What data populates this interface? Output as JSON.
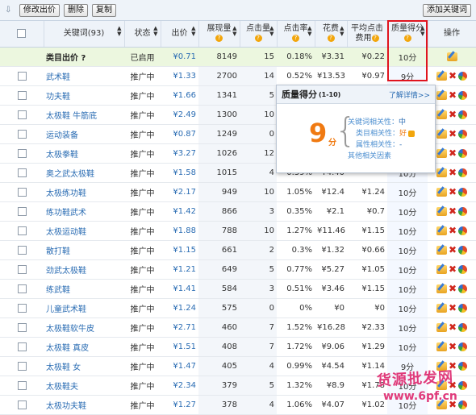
{
  "toolbar": {
    "btn_modify_bid": "修改出价",
    "btn_delete": "删除",
    "btn_copy": "复制",
    "btn_add_keyword": "添加关键词"
  },
  "headers": {
    "keyword": "关键词(93)",
    "status": "状态",
    "bid": "出价",
    "impressions": "展现量",
    "clicks": "点击量",
    "ctr": "点击率",
    "cost": "花费",
    "avg_cpc_l1": "平均点击",
    "avg_cpc_l2": "费用",
    "quality": "质量得分",
    "ops": "操作"
  },
  "category_row": {
    "name": "类目出价",
    "status": "已启用",
    "bid": "¥0.71",
    "impressions": "8149",
    "clicks": "15",
    "ctr": "0.18%",
    "cost": "¥3.31",
    "avg_cpc": "¥0.22",
    "quality": "10分"
  },
  "rows": [
    {
      "kw": "武术鞋",
      "status": "推广中",
      "bid": "¥1.33",
      "imp": "2700",
      "clk": "14",
      "ctr": "0.52%",
      "cost": "¥13.53",
      "cpc": "¥0.97",
      "qs": "9分"
    },
    {
      "kw": "功夫鞋",
      "status": "推广中",
      "bid": "¥1.66",
      "imp": "1341",
      "clk": "5",
      "ctr": "",
      "cost": "",
      "cpc": "",
      "qs": ""
    },
    {
      "kw": "太极鞋 牛筋底",
      "status": "推广中",
      "bid": "¥2.49",
      "imp": "1300",
      "clk": "10",
      "ctr": "",
      "cost": "",
      "cpc": "",
      "qs": ""
    },
    {
      "kw": "运动装备",
      "status": "推广中",
      "bid": "¥0.87",
      "imp": "1249",
      "clk": "0",
      "ctr": "",
      "cost": "",
      "cpc": "",
      "qs": ""
    },
    {
      "kw": "太极拳鞋",
      "status": "推广中",
      "bid": "¥3.27",
      "imp": "1026",
      "clk": "12",
      "ctr": "",
      "cost": "",
      "cpc": "",
      "qs": ""
    },
    {
      "kw": "奥之武太极鞋",
      "status": "推广中",
      "bid": "¥1.58",
      "imp": "1015",
      "clk": "4",
      "ctr": "0.39%",
      "cost": "¥4.40",
      "cpc": "",
      "qs": "10分"
    },
    {
      "kw": "太极练功鞋",
      "status": "推广中",
      "bid": "¥2.17",
      "imp": "949",
      "clk": "10",
      "ctr": "1.05%",
      "cost": "¥12.4",
      "cpc": "¥1.24",
      "qs": "10分"
    },
    {
      "kw": "练功鞋武术",
      "status": "推广中",
      "bid": "¥1.42",
      "imp": "866",
      "clk": "3",
      "ctr": "0.35%",
      "cost": "¥2.1",
      "cpc": "¥0.7",
      "qs": "10分"
    },
    {
      "kw": "太极运动鞋",
      "status": "推广中",
      "bid": "¥1.88",
      "imp": "788",
      "clk": "10",
      "ctr": "1.27%",
      "cost": "¥11.46",
      "cpc": "¥1.15",
      "qs": "10分"
    },
    {
      "kw": "散打鞋",
      "status": "推广中",
      "bid": "¥1.15",
      "imp": "661",
      "clk": "2",
      "ctr": "0.3%",
      "cost": "¥1.32",
      "cpc": "¥0.66",
      "qs": "10分"
    },
    {
      "kw": "劲武太极鞋",
      "status": "推广中",
      "bid": "¥1.21",
      "imp": "649",
      "clk": "5",
      "ctr": "0.77%",
      "cost": "¥5.27",
      "cpc": "¥1.05",
      "qs": "10分"
    },
    {
      "kw": "练武鞋",
      "status": "推广中",
      "bid": "¥1.41",
      "imp": "584",
      "clk": "3",
      "ctr": "0.51%",
      "cost": "¥3.46",
      "cpc": "¥1.15",
      "qs": "10分"
    },
    {
      "kw": "儿童武术鞋",
      "status": "推广中",
      "bid": "¥1.24",
      "imp": "575",
      "clk": "0",
      "ctr": "0%",
      "cost": "¥0",
      "cpc": "¥0",
      "qs": "10分"
    },
    {
      "kw": "太极鞋软牛皮",
      "status": "推广中",
      "bid": "¥2.71",
      "imp": "460",
      "clk": "7",
      "ctr": "1.52%",
      "cost": "¥16.28",
      "cpc": "¥2.33",
      "qs": "10分"
    },
    {
      "kw": "太极鞋 真皮",
      "status": "推广中",
      "bid": "¥1.51",
      "imp": "408",
      "clk": "7",
      "ctr": "1.72%",
      "cost": "¥9.06",
      "cpc": "¥1.29",
      "qs": "10分"
    },
    {
      "kw": "太极鞋 女",
      "status": "推广中",
      "bid": "¥1.47",
      "imp": "405",
      "clk": "4",
      "ctr": "0.99%",
      "cost": "¥4.54",
      "cpc": "¥1.14",
      "qs": "9分"
    },
    {
      "kw": "太极鞋夫",
      "status": "推广中",
      "bid": "¥2.34",
      "imp": "379",
      "clk": "5",
      "ctr": "1.32%",
      "cost": "¥8.9",
      "cpc": "¥1.78",
      "qs": "10分"
    },
    {
      "kw": "太极功夫鞋",
      "status": "推广中",
      "bid": "¥1.27",
      "imp": "378",
      "clk": "4",
      "ctr": "1.06%",
      "cost": "¥4.07",
      "cpc": "¥1.02",
      "qs": "10分"
    }
  ],
  "popup": {
    "title": "质量得分",
    "range": "(1-10)",
    "link": "了解详情>>",
    "score": "9",
    "score_unit": "分",
    "rel_keyword_label": "关键词相关性：",
    "rel_keyword_value": "中",
    "rel_category_label": "类目相关性：",
    "rel_category_value": "好",
    "rel_attr_label": "属性相关性：",
    "rel_attr_value": "-",
    "other": "其他相关因素"
  },
  "watermark": {
    "line1": "货源批发网",
    "line2": "www.6pf.cn"
  },
  "colors": {
    "accent_link": "#2a6cb3",
    "highlight_border": "#e0141e",
    "score_orange": "#f07a12",
    "category_row_bg": "#ecf7df"
  }
}
